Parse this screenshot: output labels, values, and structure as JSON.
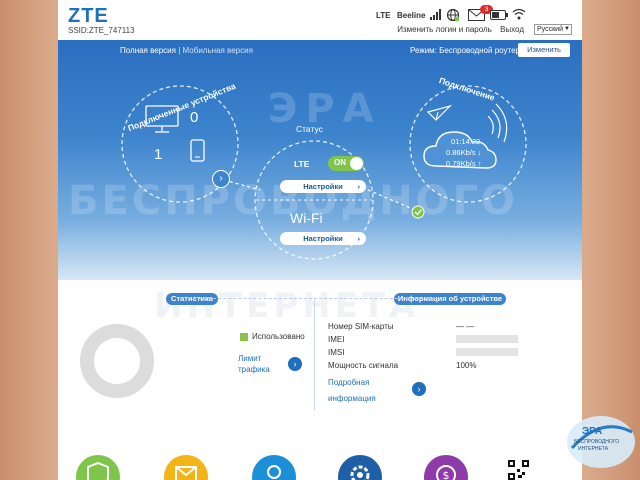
{
  "header": {
    "logo": "ZTE",
    "ssid": "SSID:ZTE_747113",
    "network_type": "LTE",
    "operator": "Beeline",
    "sms_badge": "3",
    "links": {
      "change_login": "Изменить логин и пароль",
      "logout": "Выход"
    },
    "language": "Русский"
  },
  "subnav": {
    "full_version": "Полная версия",
    "separator": "|",
    "mobile_version": "Мобильная версия",
    "mode": "Режим: Беспроводной роутер",
    "change_button": "Изменить"
  },
  "devices": {
    "title": "Подключенные устройства",
    "wifi_count": "0",
    "usb_count": "1"
  },
  "status": {
    "title": "Статус",
    "lte_label": "LTE",
    "lte_toggle": "ON",
    "lte_settings": "Настройки",
    "wifi_label": "Wi-Fi",
    "wifi_settings": "Настройки"
  },
  "connection": {
    "title": "Подключение",
    "duration": "01:14:22",
    "download": "0.86Kb/s ↓",
    "upload": "0.79Kb/s ↑"
  },
  "statistics": {
    "title": "Статистика",
    "used_label": "Использовано",
    "limit_label_line1": "Лимит",
    "limit_label_line2": "трафика"
  },
  "device_info": {
    "title": "Информация об устройстве",
    "rows": [
      {
        "label": "Номер SIM-карты",
        "value": "— —"
      },
      {
        "label": "IMEI",
        "value": ""
      },
      {
        "label": "IMSI",
        "value": ""
      },
      {
        "label": "Мощность сигнала",
        "value": "100%"
      }
    ],
    "more_line1": "Подробная",
    "more_line2": "информация"
  },
  "watermark": {
    "line1": "ЭРА",
    "line2": "БЕСПРОВОДНОГО",
    "line3": "ИНТЕРНЕТА",
    "badge_line1": "ЭРА",
    "badge_line2": "БЕСПРОВОДНОГО",
    "badge_line3": "ИНТЕРНЕТА"
  },
  "colors": {
    "accent": "#1f6fbd",
    "hero_top": "#2a6fc0",
    "toggle_on": "#7ec54a",
    "used": "#8bc34a",
    "ring": "#dcdcdc",
    "sms_badge": "#e02b2b"
  },
  "bottom_icons": [
    {
      "name": "shield-icon",
      "color": "#7ec54a"
    },
    {
      "name": "envelope-icon",
      "color": "#f2b416"
    },
    {
      "name": "user-icon",
      "color": "#1d8fd8"
    },
    {
      "name": "settings-icon",
      "color": "#1f5fa8"
    },
    {
      "name": "money-icon",
      "color": "#8e3aa8"
    }
  ]
}
